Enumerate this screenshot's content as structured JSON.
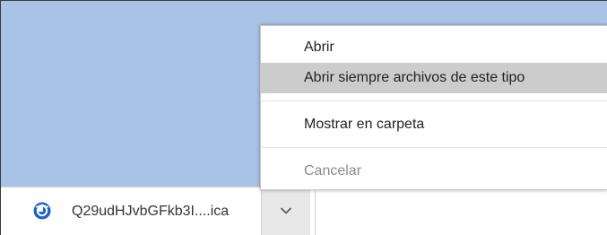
{
  "download_bar": {
    "file_name": "Q29udHJvbGFkb3I....ica",
    "file_name_display": "Q29udHJvbGFkb3I....ica",
    "file_icon": "chrome-app-icon",
    "menu_toggle_icon": "chevron-down-icon"
  },
  "context_menu": {
    "items": [
      {
        "label": "Abrir"
      },
      {
        "label": "Abrir siempre archivos de este tipo",
        "highlighted": true
      },
      {
        "label": "Mostrar en carpeta"
      },
      {
        "label": "Cancelar",
        "disabled": true
      }
    ]
  },
  "colors": {
    "page_background": "#a9c3e6",
    "menu_highlight": "#cccccc",
    "disabled_text": "#8a8a8a"
  }
}
